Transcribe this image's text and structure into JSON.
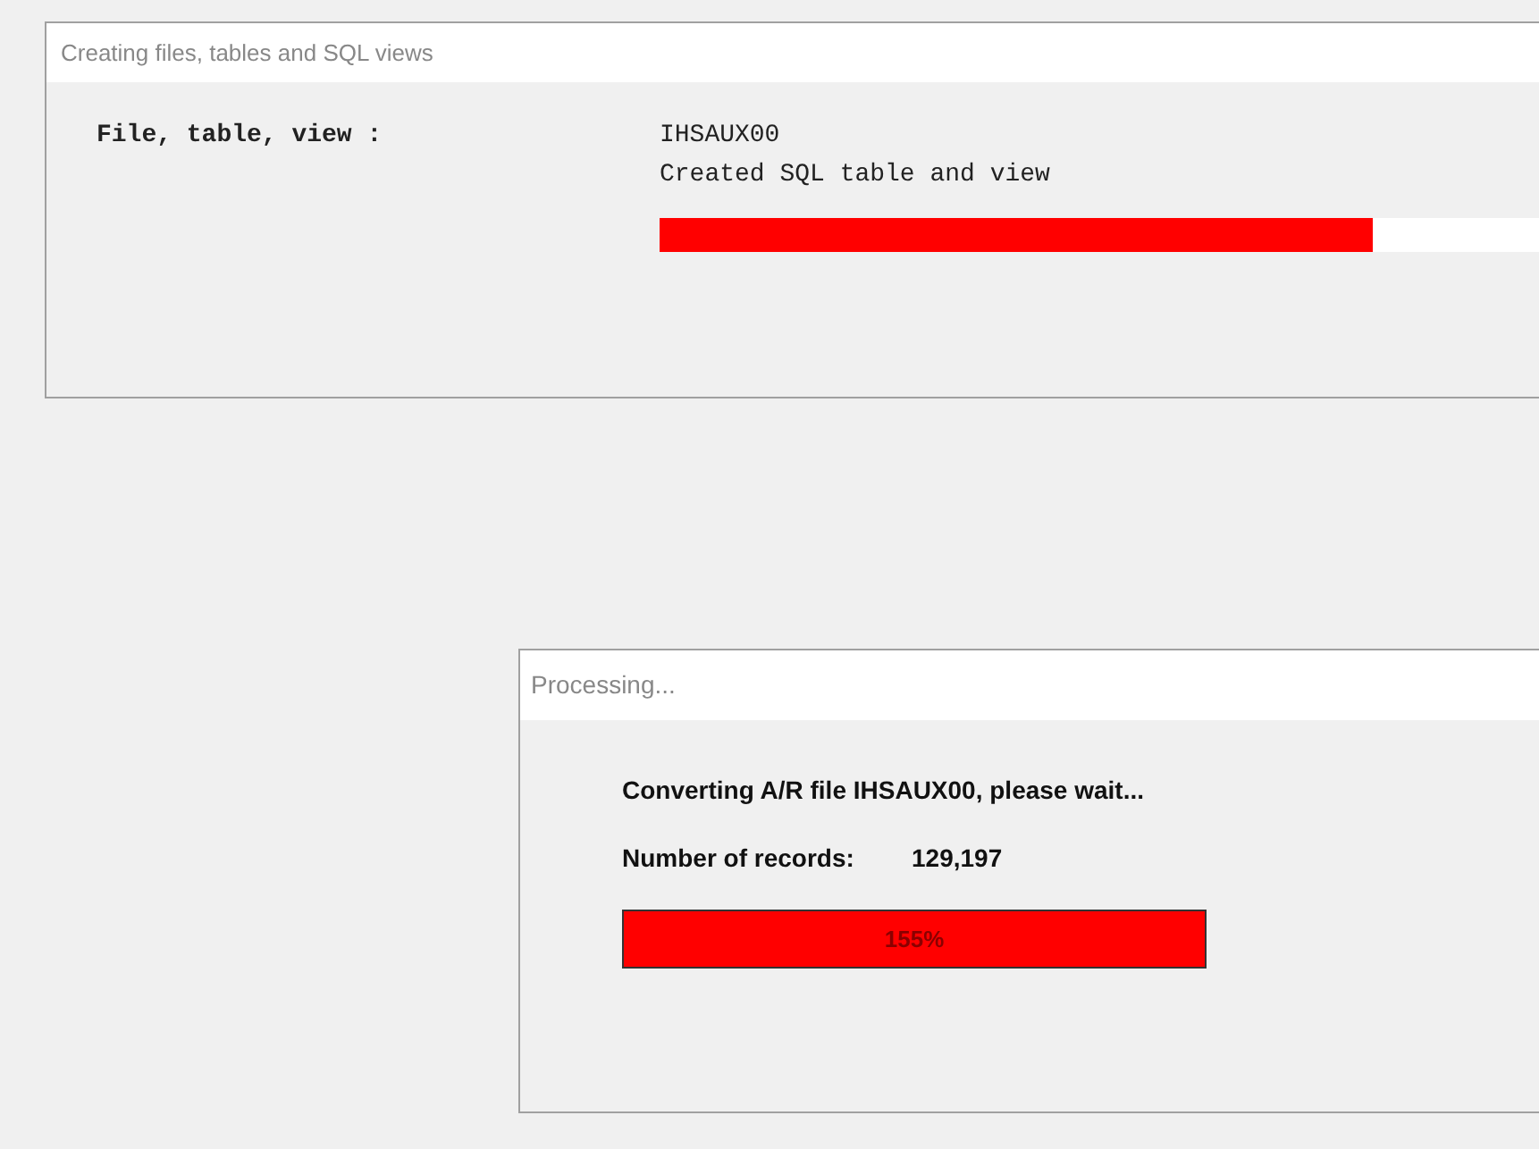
{
  "dialogs": [
    {
      "title": "Creating files, tables and SQL views",
      "label": "File, table, view :",
      "name": "IHSAUX00",
      "message": "Created SQL table and view",
      "progress": {
        "level": 0.81
      }
    },
    {
      "title": "Processing...",
      "message": "Converting A/R file IHSAUX00, please wait...",
      "records_label": "Number of records:",
      "records_value": "129,197",
      "progress": {
        "level": 1,
        "text": "155%"
      }
    }
  ]
}
